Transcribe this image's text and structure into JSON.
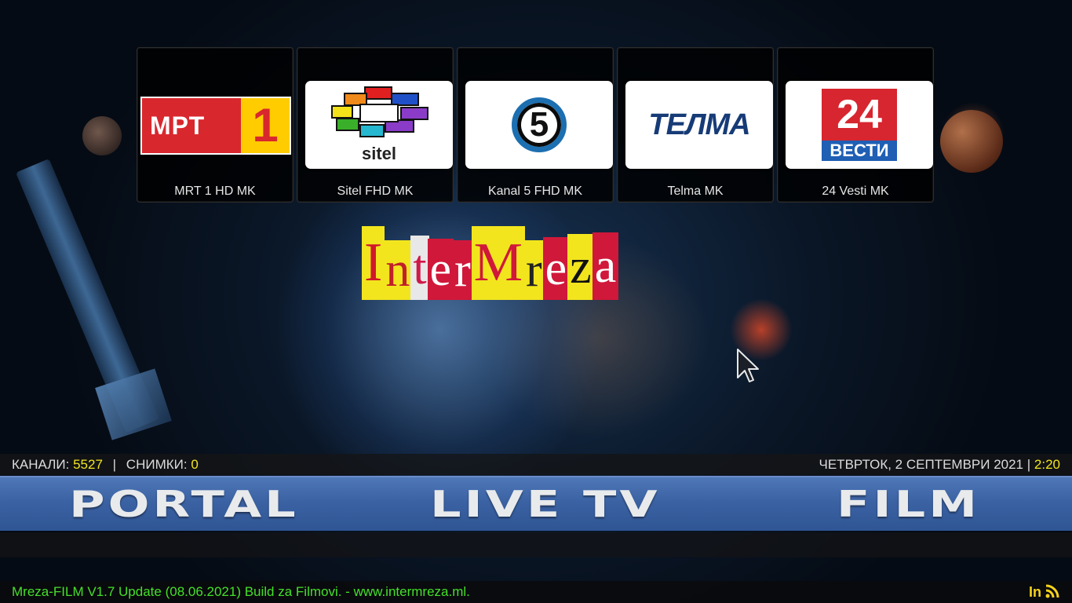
{
  "channels": [
    {
      "label": "MRT 1 HD MK",
      "logo_text": "МРТ",
      "logo_num": "1"
    },
    {
      "label": "Sitel FHD MK",
      "logo_text": "sitel"
    },
    {
      "label": "Kanal 5 FHD MK",
      "logo_text": "5"
    },
    {
      "label": "Telma MK",
      "logo_text": "ТЕЛМА"
    },
    {
      "label": "24 Vesti MK",
      "logo_text": "24",
      "logo_sub": "ВЕСТИ"
    }
  ],
  "brand": {
    "letters": [
      "I",
      "n",
      "t",
      "e",
      "r",
      "M",
      "r",
      "e",
      "z",
      "a"
    ]
  },
  "info": {
    "channels_label": "КАНАЛИ:",
    "channels_count": "5527",
    "separator": "|",
    "recordings_label": "СНИМКИ:",
    "recordings_count": "0",
    "date": "ЧЕТВРТОК, 2 СЕПТЕМВРИ 2021",
    "time_separator": "|",
    "time": "2:20"
  },
  "menu": {
    "items": [
      "PORTAL",
      "LIVE TV",
      "FILM"
    ]
  },
  "footer": {
    "text": "Mreza-FILM V1.7 Update (08.06.2021) Build za Filmovi. - www.intermreza.ml.",
    "rss_label": "In"
  },
  "colors": {
    "accent_yellow": "#f2e51e",
    "footer_green": "#44e02a",
    "menu_blue": "#3b62a3"
  },
  "icons": [
    "rss-icon",
    "mouse-cursor-icon"
  ]
}
